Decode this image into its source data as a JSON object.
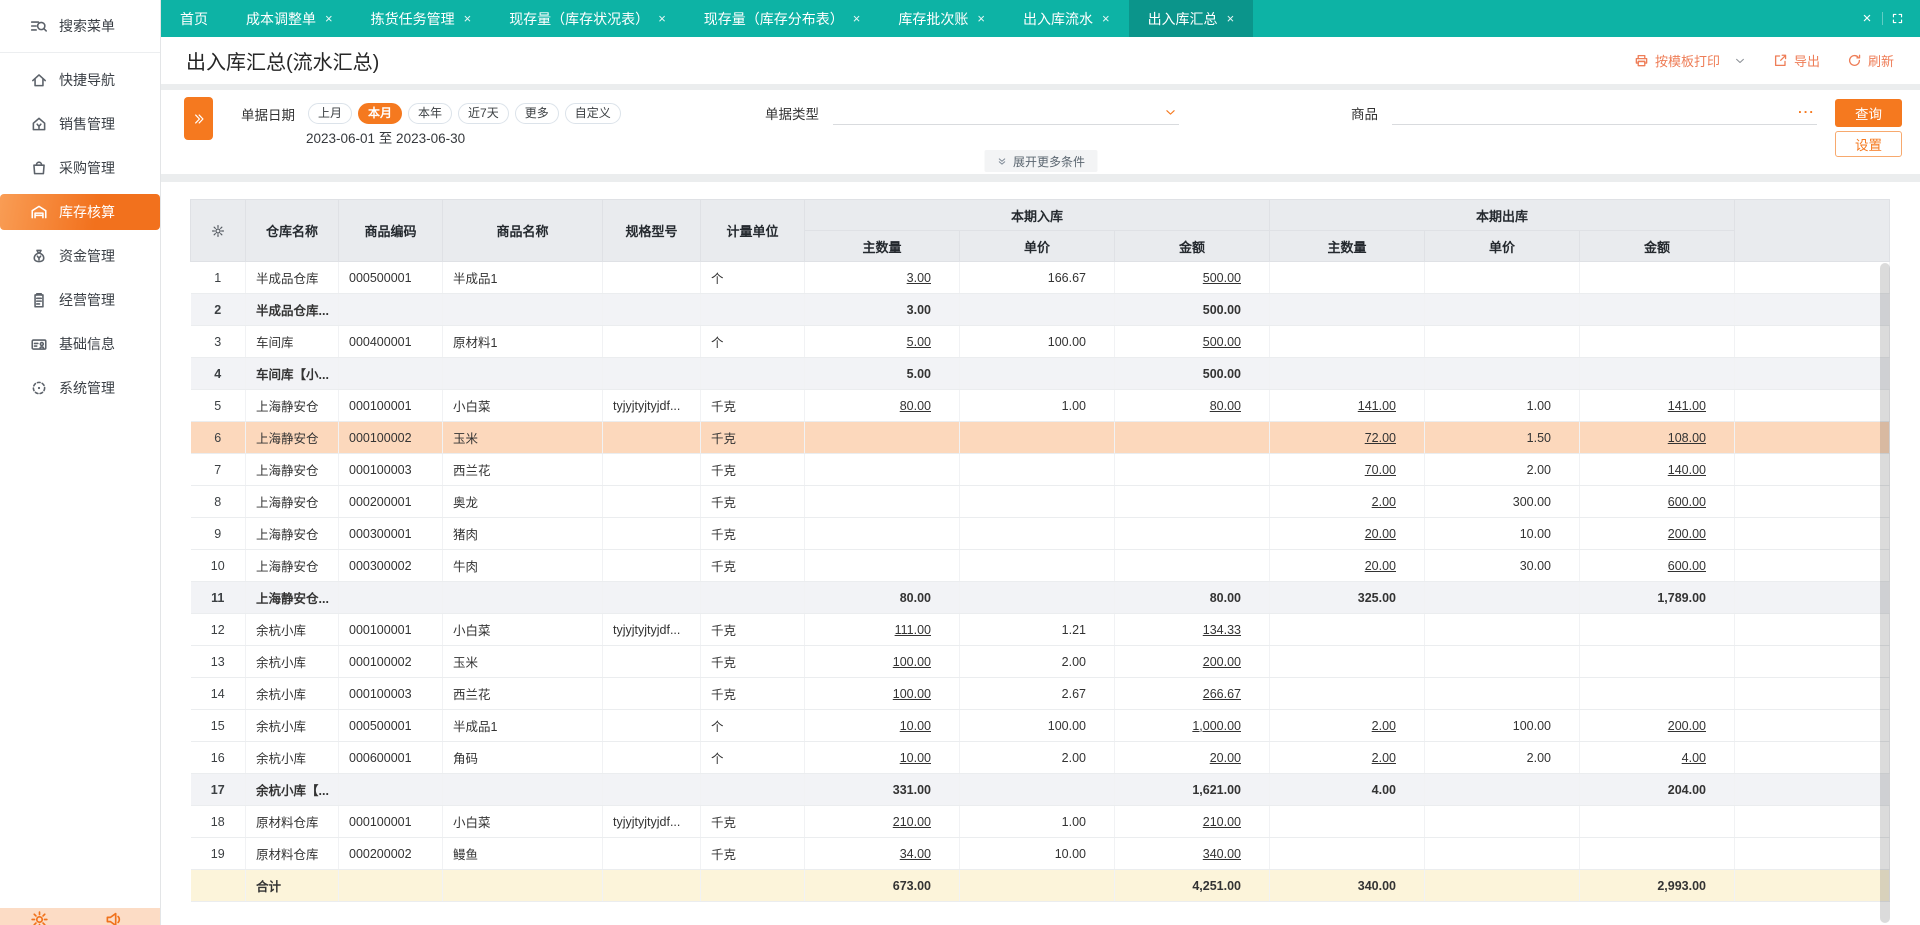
{
  "sidebar": {
    "items": [
      {
        "label": "搜索菜单",
        "icon": "search-menu-icon"
      },
      {
        "label": "快捷导航",
        "icon": "home-icon"
      },
      {
        "label": "销售管理",
        "icon": "sale-icon"
      },
      {
        "label": "采购管理",
        "icon": "bag-icon"
      },
      {
        "label": "库存核算",
        "icon": "warehouse-icon",
        "active": true
      },
      {
        "label": "资金管理",
        "icon": "moneybag-icon"
      },
      {
        "label": "经营管理",
        "icon": "clipboard-icon"
      },
      {
        "label": "基础信息",
        "icon": "idcard-icon"
      },
      {
        "label": "系统管理",
        "icon": "system-icon"
      }
    ],
    "bottom_icons": [
      "gear-icon",
      "speaker-icon"
    ]
  },
  "tabbar": {
    "tabs": [
      {
        "label": "首页",
        "closable": false
      },
      {
        "label": "成本调整单",
        "closable": true
      },
      {
        "label": "拣货任务管理",
        "closable": true
      },
      {
        "label": "现存量（库存状况表）",
        "closable": true
      },
      {
        "label": "现存量（库存分布表）",
        "closable": true
      },
      {
        "label": "库存批次账",
        "closable": true
      },
      {
        "label": "出入库流水",
        "closable": true
      },
      {
        "label": "出入库汇总",
        "closable": true,
        "active": true
      }
    ],
    "close_all_label": "×"
  },
  "header": {
    "title": "出入库汇总(流水汇总)",
    "actions": [
      {
        "label": "按模板打印",
        "icon": "printer-icon",
        "has_dropdown": true
      },
      {
        "label": "导出",
        "icon": "export-icon"
      },
      {
        "label": "刷新",
        "icon": "refresh-icon"
      }
    ]
  },
  "filters": {
    "date_label": "单据日期",
    "date_options": [
      "上月",
      "本月",
      "本年",
      "近7天",
      "更多",
      "自定义"
    ],
    "date_selected": "本月",
    "date_range": "2023-06-01 至 2023-06-30",
    "doc_type_label": "单据类型",
    "doc_type_value": "",
    "product_label": "商品",
    "product_value": "",
    "product_more": "...",
    "search_button": "查询",
    "settings_button": "设置",
    "expand_more": "展开更多条件"
  },
  "table": {
    "group_in": "本期入库",
    "group_out": "本期出库",
    "columns": [
      "仓库名称",
      "商品编码",
      "商品名称",
      "规格型号",
      "计量单位"
    ],
    "sub_columns": [
      "主数量",
      "单价",
      "金额"
    ],
    "total_label": "合计",
    "rows": [
      {
        "type": "detail",
        "cells": [
          "1",
          "半成品仓库",
          "000500001",
          "半成品1",
          "",
          "个",
          "3.00",
          "166.67",
          "500.00",
          "",
          "",
          ""
        ]
      },
      {
        "type": "subtotal",
        "cells": [
          "2",
          "半成品仓库...",
          "",
          "",
          "",
          "",
          "3.00",
          "",
          "500.00",
          "",
          "",
          ""
        ]
      },
      {
        "type": "detail",
        "cells": [
          "3",
          "车间库",
          "000400001",
          "原材料1",
          "",
          "个",
          "5.00",
          "100.00",
          "500.00",
          "",
          "",
          ""
        ]
      },
      {
        "type": "subtotal",
        "cells": [
          "4",
          "车间库【小...",
          "",
          "",
          "",
          "",
          "5.00",
          "",
          "500.00",
          "",
          "",
          ""
        ]
      },
      {
        "type": "detail",
        "cells": [
          "5",
          "上海静安仓",
          "000100001",
          "小白菜",
          "tyjyjtyjtyjdf...",
          "千克",
          "80.00",
          "1.00",
          "80.00",
          "141.00",
          "1.00",
          "141.00"
        ]
      },
      {
        "type": "detail",
        "selected": true,
        "cells": [
          "6",
          "上海静安仓",
          "000100002",
          "玉米",
          "",
          "千克",
          "",
          "",
          "",
          "72.00",
          "1.50",
          "108.00"
        ]
      },
      {
        "type": "detail",
        "cells": [
          "7",
          "上海静安仓",
          "000100003",
          "西兰花",
          "",
          "千克",
          "",
          "",
          "",
          "70.00",
          "2.00",
          "140.00"
        ]
      },
      {
        "type": "detail",
        "cells": [
          "8",
          "上海静安仓",
          "000200001",
          "奥龙",
          "",
          "千克",
          "",
          "",
          "",
          "2.00",
          "300.00",
          "600.00"
        ]
      },
      {
        "type": "detail",
        "cells": [
          "9",
          "上海静安仓",
          "000300001",
          "猪肉",
          "",
          "千克",
          "",
          "",
          "",
          "20.00",
          "10.00",
          "200.00"
        ]
      },
      {
        "type": "detail",
        "cells": [
          "10",
          "上海静安仓",
          "000300002",
          "牛肉",
          "",
          "千克",
          "",
          "",
          "",
          "20.00",
          "30.00",
          "600.00"
        ]
      },
      {
        "type": "subtotal",
        "cells": [
          "11",
          "上海静安仓...",
          "",
          "",
          "",
          "",
          "80.00",
          "",
          "80.00",
          "325.00",
          "",
          "1,789.00"
        ]
      },
      {
        "type": "detail",
        "cells": [
          "12",
          "余杭小库",
          "000100001",
          "小白菜",
          "tyjyjtyjtyjdf...",
          "千克",
          "111.00",
          "1.21",
          "134.33",
          "",
          "",
          ""
        ]
      },
      {
        "type": "detail",
        "cells": [
          "13",
          "余杭小库",
          "000100002",
          "玉米",
          "",
          "千克",
          "100.00",
          "2.00",
          "200.00",
          "",
          "",
          ""
        ]
      },
      {
        "type": "detail",
        "cells": [
          "14",
          "余杭小库",
          "000100003",
          "西兰花",
          "",
          "千克",
          "100.00",
          "2.67",
          "266.67",
          "",
          "",
          ""
        ]
      },
      {
        "type": "detail",
        "cells": [
          "15",
          "余杭小库",
          "000500001",
          "半成品1",
          "",
          "个",
          "10.00",
          "100.00",
          "1,000.00",
          "2.00",
          "100.00",
          "200.00"
        ]
      },
      {
        "type": "detail",
        "cells": [
          "16",
          "余杭小库",
          "000600001",
          "角码",
          "",
          "个",
          "10.00",
          "2.00",
          "20.00",
          "2.00",
          "2.00",
          "4.00"
        ]
      },
      {
        "type": "subtotal",
        "cells": [
          "17",
          "余杭小库【...",
          "",
          "",
          "",
          "",
          "331.00",
          "",
          "1,621.00",
          "4.00",
          "",
          "204.00"
        ]
      },
      {
        "type": "detail",
        "cells": [
          "18",
          "原材料仓库",
          "000100001",
          "小白菜",
          "tyjyjtyjtyjdf...",
          "千克",
          "210.00",
          "1.00",
          "210.00",
          "",
          "",
          ""
        ]
      },
      {
        "type": "detail",
        "cells": [
          "19",
          "原材料仓库",
          "000200002",
          "鳗鱼",
          "",
          "千克",
          "34.00",
          "10.00",
          "340.00",
          "",
          "",
          ""
        ]
      },
      {
        "type": "total",
        "cells": [
          "",
          "合计",
          "",
          "",
          "",
          "",
          "673.00",
          "",
          "4,251.00",
          "340.00",
          "",
          "2,993.00"
        ]
      }
    ]
  },
  "colors": {
    "accent_orange": "#f5791f",
    "tabbar_teal": "#0db3a5",
    "tab_active_teal": "#0b958b",
    "action_link_coral": "#ee7d57",
    "selected_row": "#fcd8bc",
    "subtotal_row": "#f2f3f6",
    "total_row": "#fcf4da",
    "table_header": "#e9ebee",
    "sidebar_bottom_bar": "#fcdcc5"
  }
}
